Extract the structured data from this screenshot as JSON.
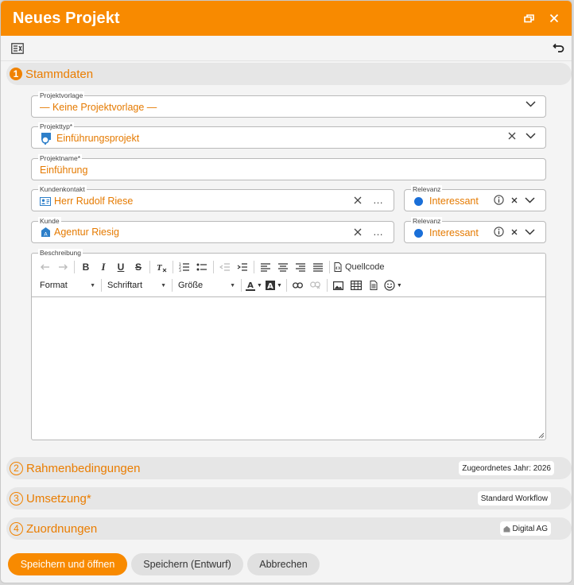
{
  "window": {
    "title": "Neues Projekt"
  },
  "toolbar": {
    "left_icon": "form-settings-icon",
    "right_icon": "undo-icon"
  },
  "sections": [
    {
      "num": "1",
      "title": "Stammdaten",
      "badge": ""
    },
    {
      "num": "2",
      "title": "Rahmenbedingungen",
      "badge": "Zugeordnetes Jahr: 2026"
    },
    {
      "num": "3",
      "title": "Umsetzung*",
      "badge": "Standard Workflow"
    },
    {
      "num": "4",
      "title": "Zuordnungen",
      "badge": "Digital AG"
    }
  ],
  "fields": {
    "projektvorlage": {
      "label": "Projektvorlage",
      "value": "— Keine Projektvorlage —"
    },
    "projekttyp": {
      "label": "Projekttyp*",
      "value": "Einführungsprojekt"
    },
    "projektname": {
      "label": "Projektname*",
      "value": "Einführung"
    },
    "kundenkontakt": {
      "label": "Kundenkontakt",
      "value": "Herr Rudolf Riese"
    },
    "relevanz1": {
      "label": "Relevanz",
      "value": "Interessant"
    },
    "kunde": {
      "label": "Kunde",
      "value": "Agentur Riesig"
    },
    "relevanz2": {
      "label": "Relevanz",
      "value": "Interessant"
    },
    "beschreibung": {
      "label": "Beschreibung",
      "value": ""
    }
  },
  "editor": {
    "source_label": "Quellcode",
    "format_label": "Format",
    "font_label": "Schriftart",
    "size_label": "Größe",
    "bold": "B",
    "italic": "I",
    "underline": "U",
    "strike": "S"
  },
  "buttons": {
    "save_open": "Speichern und öffnen",
    "save_draft": "Speichern (Entwurf)",
    "cancel": "Abbrechen"
  },
  "colors": {
    "accent": "#f88a00",
    "relevance_dot": "#1a6fd8",
    "icon_blue": "#2d7fc9"
  }
}
